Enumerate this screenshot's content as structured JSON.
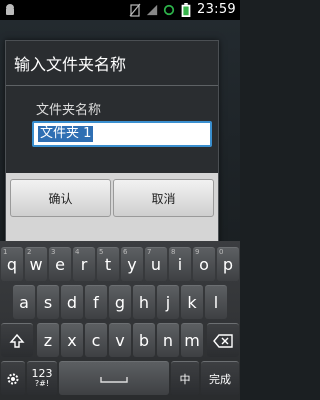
{
  "status_bar": {
    "time": "23:59",
    "icons": [
      "android-icon",
      "no-sim-icon",
      "signal-icon",
      "sync-icon",
      "battery-icon"
    ]
  },
  "dialog": {
    "title": "输入文件夹名称",
    "field_label": "文件夹名称",
    "input_value": "文件夹 1",
    "ok_label": "确认",
    "cancel_label": "取消"
  },
  "keyboard": {
    "row1": [
      {
        "key": "q",
        "sub": "1"
      },
      {
        "key": "w",
        "sub": "2"
      },
      {
        "key": "e",
        "sub": "3"
      },
      {
        "key": "r",
        "sub": "4"
      },
      {
        "key": "t",
        "sub": "5"
      },
      {
        "key": "y",
        "sub": "6"
      },
      {
        "key": "u",
        "sub": "7"
      },
      {
        "key": "i",
        "sub": "8"
      },
      {
        "key": "o",
        "sub": "9"
      },
      {
        "key": "p",
        "sub": "0"
      }
    ],
    "row2": [
      "a",
      "s",
      "d",
      "f",
      "g",
      "h",
      "j",
      "k",
      "l"
    ],
    "row3": [
      "z",
      "x",
      "c",
      "v",
      "b",
      "n",
      "m"
    ],
    "mode_label": "123",
    "mode_sub": "?#!",
    "lang_label": "中",
    "done_label": "完成"
  },
  "colors": {
    "accent": "#3a8fcf",
    "selection": "#2f6fb3"
  }
}
